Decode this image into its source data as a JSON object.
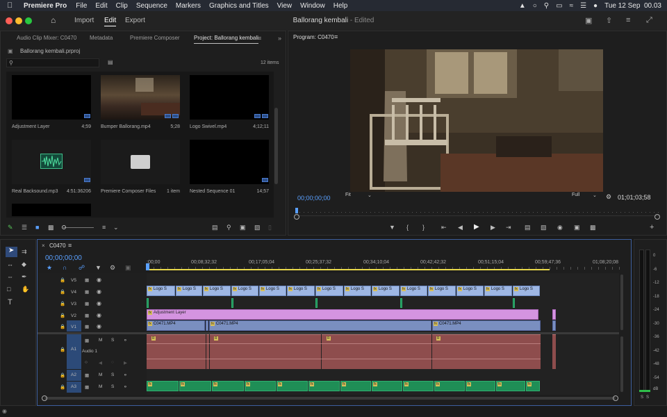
{
  "menubar": {
    "app": "Premiere Pro",
    "items": [
      "File",
      "Edit",
      "Clip",
      "Sequence",
      "Markers",
      "Graphics and Titles",
      "View",
      "Window",
      "Help"
    ],
    "clock": "Tue 12 Sep  00.03"
  },
  "titlebar": {
    "workspaces": [
      "Import",
      "Edit",
      "Export"
    ],
    "active_workspace": "Edit",
    "title": "Ballorang kembali",
    "status": "- Edited"
  },
  "project": {
    "tabs": [
      "Audio Clip Mixer: C0470",
      "Metadata",
      "Premiere Composer",
      "Project: Ballorang kembali"
    ],
    "active_tab": "Project: Ballorang kembali",
    "file": "Ballorang kembali.prproj",
    "search_placeholder": "",
    "item_count": "12 items",
    "items": [
      {
        "name": "Adjustment Layer",
        "meta": "4;59"
      },
      {
        "name": "Bumper Ballorang.mp4",
        "meta": "5;28"
      },
      {
        "name": "Logo Swivel.mp4",
        "meta": "4;12;11"
      },
      {
        "name": "Real Backsound.mp3",
        "meta": "4:51:36206"
      },
      {
        "name": "Premiere Composer Files",
        "meta": "1 item"
      },
      {
        "name": "Nested Sequence 01",
        "meta": "14;57"
      }
    ]
  },
  "program": {
    "tab": "Program: C0470",
    "timecode": "00;00;00;00",
    "fit": "Fit",
    "quality": "Full",
    "duration": "01;01;03;58"
  },
  "timeline": {
    "sequence": "C0470",
    "timecode": "00;00;00;00",
    "ruler": [
      ":00;00",
      "00;08;32;32",
      "00;17;05;04",
      "00;25;37;32",
      "00;34;10;04",
      "00;42;42;32",
      "00;51;15;04",
      "00;59;47;36",
      "01;08;20;08"
    ],
    "video_tracks": [
      "V5",
      "V4",
      "V3",
      "V2",
      "V1"
    ],
    "audio_tracks": [
      "A1",
      "A2",
      "A3"
    ],
    "audio1_name": "Audio 1",
    "logo_clip": "Logo S",
    "adjustment_clip": "Adjustment Layer",
    "video_clip": "C0471.MP4",
    "m_label": "M",
    "s_label": "S",
    "fx_label": "fx",
    "r_label": "R"
  },
  "meter": {
    "labels": [
      "0",
      "-6",
      "-12",
      "-18",
      "-24",
      "-30",
      "-36",
      "-42",
      "-48",
      "-54",
      "dB"
    ],
    "solo": [
      "S",
      "S"
    ]
  }
}
